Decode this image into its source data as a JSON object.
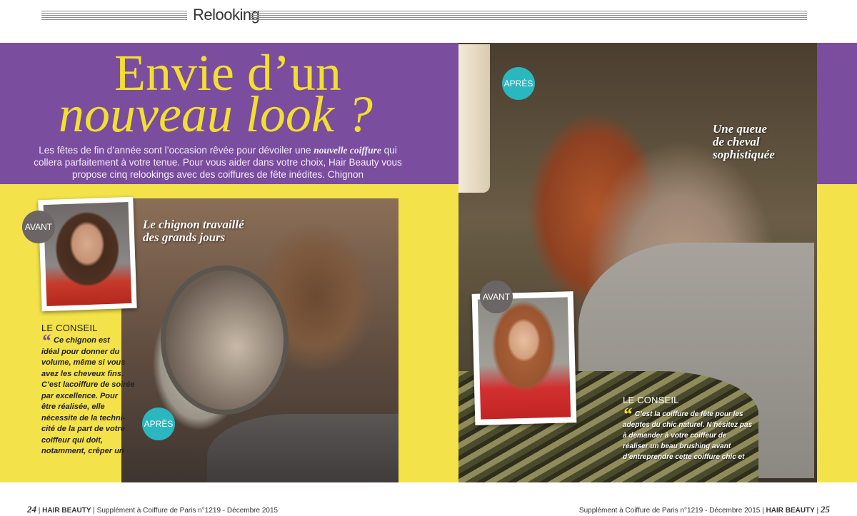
{
  "header": {
    "section": "Relooking"
  },
  "title": {
    "line1": "Envie d’un",
    "line2": "nouveau look ?"
  },
  "intro": {
    "text_before": "Les fêtes de fin d’année sont l’occasion rêvée pour dévoiler une ",
    "emphasis": "nouvelle coiffure",
    "text_after": " qui collera parfaitement à votre tenue. Pour vous aider dans votre choix,  Hair Beauty vous propose cinq relookings avec des coiffures de fête inédites. Chignon"
  },
  "left": {
    "badge_before": "AVANT",
    "badge_after": "APRÈS",
    "caption": [
      "Le chignon travaillé",
      "des grands jours"
    ],
    "conseil_title": "LE CONSEIL",
    "conseil_lines": [
      "Ce chignon est",
      "idéal pour donner du",
      "volume, même si vous",
      "avez les cheveux fins.",
      "C’est lacoiffure de soirée",
      "par excellence. Pour",
      "être réalisée, elle",
      "nécessite de la techni-",
      "cité de la part de votre",
      "coiffeur qui doit,",
      "notamment, crêper un"
    ]
  },
  "right": {
    "badge_after": "APRÈS",
    "badge_before": "AVANT",
    "caption": [
      "Une queue",
      "de cheval",
      "sophistiquée"
    ],
    "conseil_title": "LE CONSEIL",
    "conseil_lines": [
      "C’est la coiffure de fête pour les",
      "adeptes du chic naturel. N’hésitez pas",
      "à demander à votre coiffeur de",
      "réaliser un beau brushing avant",
      "d’entreprendre cette coiffure chic et"
    ]
  },
  "footer": {
    "left_page": "24",
    "magazine": "HAIR BEAUTY",
    "supplement": "Supplément à Coiffure de Paris n°1219 - Décembre 2015",
    "right_page": "25"
  },
  "colors": {
    "purple": "#7a4d9f",
    "yellow": "#f4e24a",
    "title_yellow": "#f2df2f",
    "teal_badge": "#2bb7c0",
    "gray_badge": "#6b6566"
  }
}
